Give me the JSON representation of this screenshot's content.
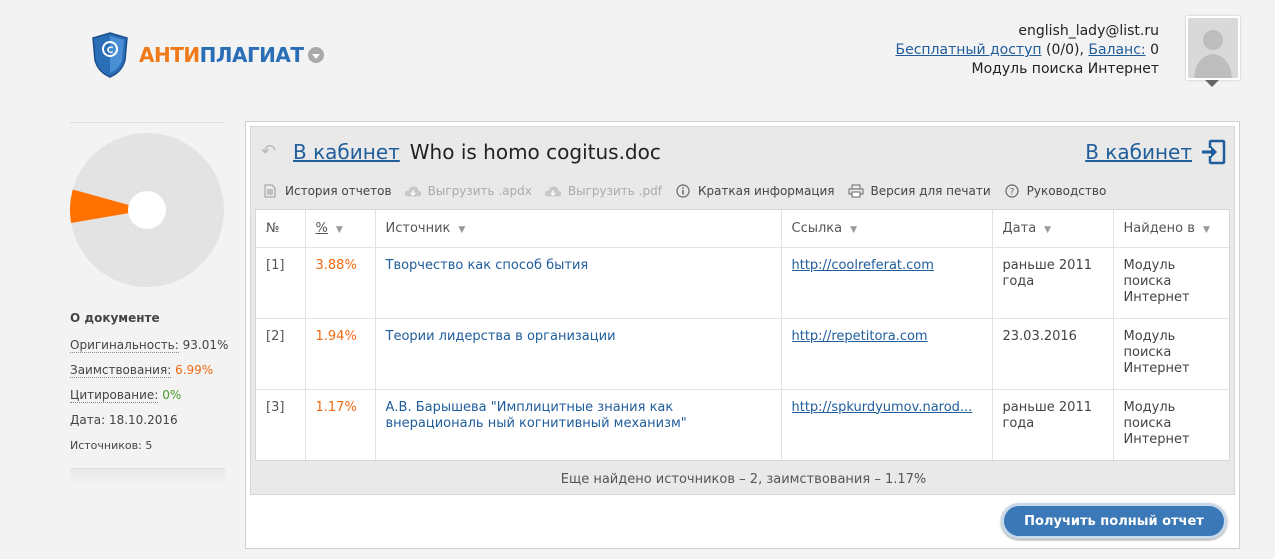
{
  "logo": {
    "part1": "АНТИ",
    "part2": "ПЛАГИАТ"
  },
  "user": {
    "email": "english_lady@list.ru",
    "free_access_link": "Бесплатный доступ",
    "free_access_value": "(0/0),",
    "balance_link": "Баланс:",
    "balance_value": "0",
    "module": "Модуль поиска Интернет"
  },
  "colors": {
    "accent": "#1f5d9c",
    "borrow": "#f06a10",
    "cite": "#4a9a2a",
    "pie_bg": "#e3e3e3",
    "pie_slice": "#ff7200"
  },
  "chart_data": {
    "type": "pie",
    "values": [
      93.01,
      6.99,
      0
    ]
  },
  "doc_info": {
    "title": "О документе",
    "originality_label": "Оригинальность:",
    "originality_value": "93.01%",
    "borrow_label": "Заимствования:",
    "borrow_value": "6.99%",
    "cite_label": "Цитирование:",
    "cite_value": "0%",
    "date_label": "Дата:",
    "date_value": "18.10.2016",
    "sources_label": "Источников:",
    "sources_value": "5"
  },
  "header": {
    "back_link": "В кабинет",
    "file_name": "Who is homo cogitus.doc",
    "right_link": "В кабинет"
  },
  "toolbar": {
    "history": "История отчетов",
    "export_apdx": "Выгрузить .apdx",
    "export_pdf": "Выгрузить .pdf",
    "info": "Краткая информация",
    "print": "Версия для печати",
    "guide": "Руководство"
  },
  "table": {
    "headers": {
      "num": "№",
      "pct": "%",
      "source": "Источник",
      "link": "Ссылка",
      "date": "Дата",
      "found": "Найдено в"
    },
    "rows": [
      {
        "num": "[1]",
        "pct": "3.88%",
        "source": "Творчество как способ бытия",
        "link": "http://coolreferat.com",
        "date": "раньше 2011 года",
        "found": "Модуль поиска Интернет"
      },
      {
        "num": "[2]",
        "pct": "1.94%",
        "source": "Теории лидерства в организации",
        "link": "http://repetitora.com",
        "date": "23.03.2016",
        "found": "Модуль поиска Интернет"
      },
      {
        "num": "[3]",
        "pct": "1.17%",
        "source": "А.В. Барышева \"Имплицитные знания как внерациональ ный когнитивный механизм\"",
        "link": "http://spkurdyumov.narod...",
        "date": "раньше 2011 года",
        "found": "Модуль поиска Интернет"
      }
    ]
  },
  "more_text": "Еще найдено источников – 2, заимствования – 1.17%",
  "full_report_button": "Получить полный отчет"
}
